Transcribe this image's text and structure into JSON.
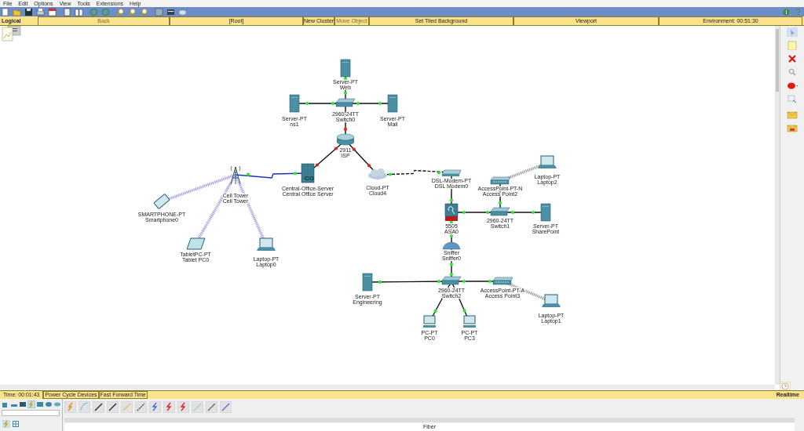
{
  "menu": [
    "File",
    "Edit",
    "Options",
    "View",
    "Tools",
    "Extensions",
    "Help"
  ],
  "workspace_tab": "Logical",
  "nav_buttons": [
    {
      "label": "Back",
      "disabled": true
    },
    {
      "label": "[Root]",
      "disabled": false
    },
    {
      "label": "New Cluster",
      "disabled": false
    },
    {
      "label": "Move Object",
      "disabled": true
    },
    {
      "label": "Set Tiled Background",
      "disabled": false
    },
    {
      "label": "Viewport",
      "disabled": false
    },
    {
      "label": "Environment: 00:51:30",
      "disabled": false
    }
  ],
  "devices": [
    {
      "kind": "server",
      "model": "Server-PT",
      "name": "Web"
    },
    {
      "kind": "server",
      "model": "Server-PT",
      "name": "ns1"
    },
    {
      "kind": "switch",
      "model": "2960-24TT",
      "name": "Switch0"
    },
    {
      "kind": "server",
      "model": "Server-PT",
      "name": "Mail"
    },
    {
      "kind": "router",
      "model": "2911",
      "name": "ISP"
    },
    {
      "kind": "co-server",
      "model": "Central-Office-Server",
      "name": "Central Office Server",
      "icon_text": "CO"
    },
    {
      "kind": "cell-tower",
      "model": "Cell Tower",
      "name": "Cell Tower"
    },
    {
      "kind": "cloud",
      "model": "Cloud-PT",
      "name": "Cloud4"
    },
    {
      "kind": "smartphone",
      "model": "SMARTPHONE-PT",
      "name": "Smartphone0"
    },
    {
      "kind": "tablet",
      "model": "TabletPC-PT",
      "name": "Tablet PC0"
    },
    {
      "kind": "laptop",
      "model": "Laptop-PT",
      "name": "Laptop0"
    },
    {
      "kind": "modem",
      "model": "DSL-Modem-PT",
      "name": "DSL Modem0"
    },
    {
      "kind": "access-point",
      "model": "AccessPoint-PT-N",
      "name": "Access Point2"
    },
    {
      "kind": "laptop",
      "model": "Laptop-PT",
      "name": "Laptop2"
    },
    {
      "kind": "firewall",
      "model": "5505",
      "name": "ASA0"
    },
    {
      "kind": "switch",
      "model": "2960-24TT",
      "name": "Switch1"
    },
    {
      "kind": "server",
      "model": "Server-PT",
      "name": "SharePoint"
    },
    {
      "kind": "sniffer",
      "model": "Sniffer",
      "name": "Sniffer0"
    },
    {
      "kind": "server",
      "model": "Server-PT",
      "name": "Engineering"
    },
    {
      "kind": "switch",
      "model": "2960-24TT",
      "name": "Switch2"
    },
    {
      "kind": "access-point",
      "model": "AccessPoint-PT-A",
      "name": "Access Point3"
    },
    {
      "kind": "laptop",
      "model": "Laptop-PT",
      "name": "Laptop1"
    },
    {
      "kind": "pc",
      "model": "PC-PT",
      "name": "PC0"
    },
    {
      "kind": "pc",
      "model": "PC-PT",
      "name": "PC3"
    }
  ],
  "links": [
    {
      "kind": "copper",
      "up": true
    },
    {
      "kind": "copper",
      "up": true
    },
    {
      "kind": "copper",
      "up": true
    },
    {
      "kind": "copper",
      "up": false
    },
    {
      "kind": "copper",
      "up": false
    },
    {
      "kind": "copper",
      "up": false
    },
    {
      "kind": "coaxial",
      "up": true
    },
    {
      "kind": "phone",
      "up": true
    },
    {
      "kind": "cellular"
    },
    {
      "kind": "cellular"
    },
    {
      "kind": "cellular"
    },
    {
      "kind": "copper",
      "up": true
    },
    {
      "kind": "copper",
      "up": true
    },
    {
      "kind": "copper",
      "up": true
    },
    {
      "kind": "copper",
      "up": true
    },
    {
      "kind": "wireless"
    },
    {
      "kind": "copper",
      "up": true
    },
    {
      "kind": "copper",
      "up": true
    },
    {
      "kind": "copper",
      "up": true
    },
    {
      "kind": "copper",
      "up": true
    },
    {
      "kind": "wireless"
    },
    {
      "kind": "copper",
      "up": true
    },
    {
      "kind": "copper",
      "up": true
    }
  ],
  "status_bar": {
    "time": "Time: 00:01:43",
    "buttons": [
      "Power Cycle Devices",
      "Fast Forward Time"
    ],
    "mode": "Realtime"
  },
  "device_categories": [
    {
      "selected": false
    },
    {
      "selected": false
    },
    {
      "selected": false
    },
    {
      "selected": true
    },
    {
      "selected": false
    },
    {
      "selected": false
    },
    {
      "selected": false
    }
  ],
  "cable_caption": "Fiber"
}
